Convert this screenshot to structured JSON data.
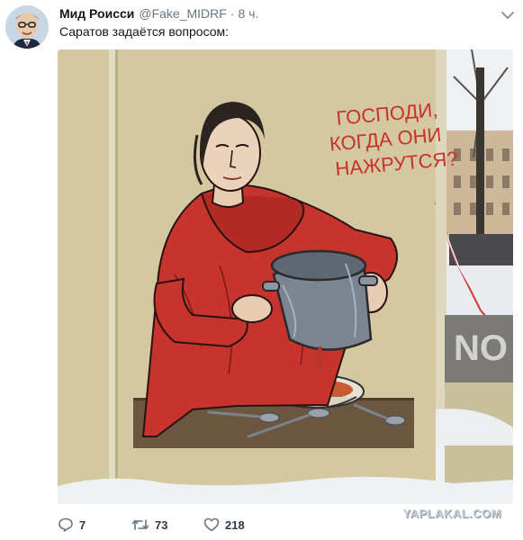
{
  "tweet": {
    "display_name": "Мид Роисси",
    "handle": "@Fake_MIDRF",
    "separator": "·",
    "time": "8 ч.",
    "text": "Саратов задаётся вопросом:",
    "menu_icon": "chevron-down-icon",
    "avatar_icon": "caricature-avatar"
  },
  "image": {
    "caption_lines": [
      "ГОСПОДИ,",
      "КОГДА ОНИ",
      "НАЖРУТСЯ?"
    ],
    "caption_color": "#c8322b"
  },
  "actions": {
    "reply": {
      "icon": "reply-icon",
      "count": "7"
    },
    "retweet": {
      "icon": "retweet-icon",
      "count": "73"
    },
    "like": {
      "icon": "heart-icon",
      "count": "218"
    }
  },
  "watermark": "YAPLAKAL.COM"
}
